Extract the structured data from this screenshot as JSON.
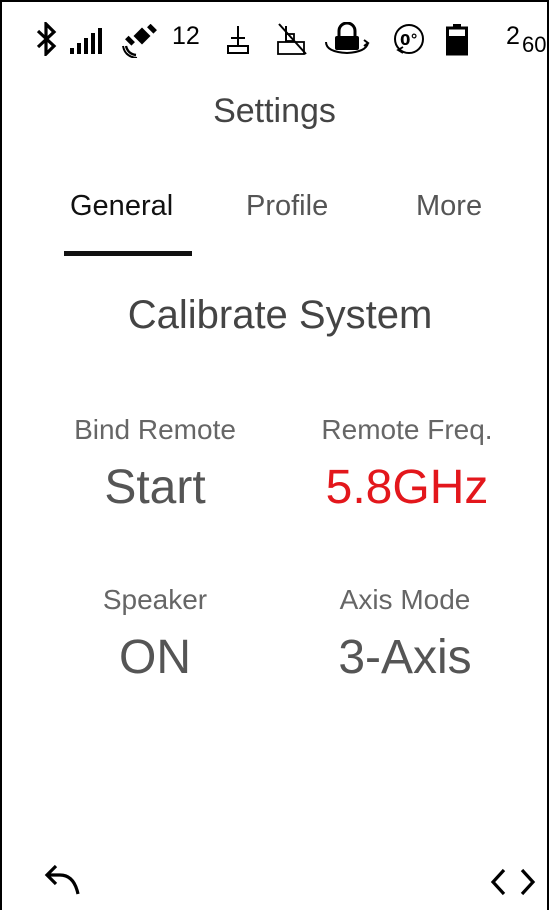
{
  "status_bar": {
    "icons": [
      "bluetooth-icon",
      "signal-bars-icon",
      "satellite-icon",
      "antenna-icon",
      "tilt-disabled-icon",
      "lock-rotate-icon",
      "zero-degree-icon",
      "battery-icon"
    ],
    "satellite_count": "12",
    "battery_count": "2",
    "battery_percent": "60%"
  },
  "header": {
    "title": "Settings"
  },
  "tabs": [
    {
      "label": "General",
      "active": true
    },
    {
      "label": "Profile",
      "active": false
    },
    {
      "label": "More",
      "active": false
    }
  ],
  "section": {
    "title": "Calibrate System"
  },
  "settings": [
    {
      "label": "Bind Remote",
      "value": "Start"
    },
    {
      "label": "Remote Freq.",
      "value": "5.8GHz",
      "value_color": "#e3171c"
    },
    {
      "label": "Speaker",
      "value": "ON"
    },
    {
      "label": "Axis Mode",
      "value": "3-Axis"
    }
  ],
  "footer": {
    "back_icon": "back-arrow-icon",
    "nav_icon": "left-right-chevrons-icon"
  }
}
